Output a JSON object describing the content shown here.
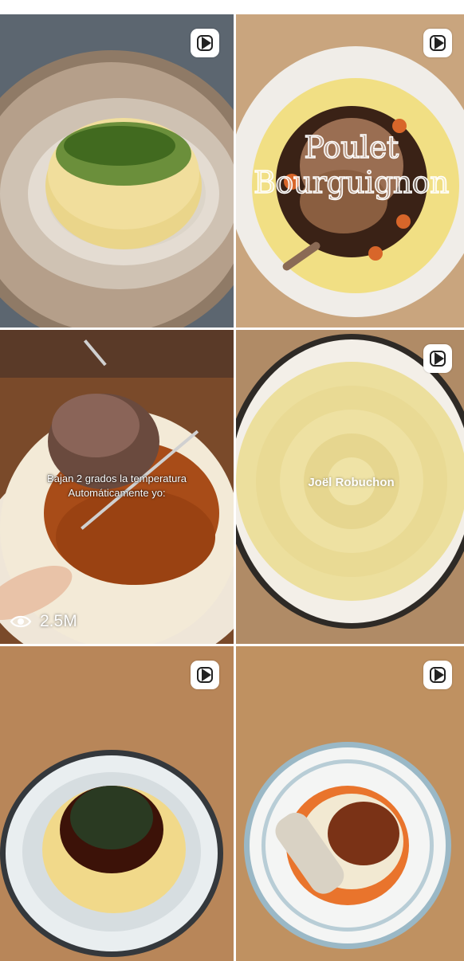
{
  "tiles": [
    {
      "id": "puree-chives",
      "is_reel": true
    },
    {
      "id": "poulet-bourguignon",
      "is_reel": true,
      "title": "Poulet\nBourguignon"
    },
    {
      "id": "braised-beef",
      "is_reel": false,
      "caption_line1": "Bajan 2 grados la temperatura",
      "caption_line2": "Automáticamente yo:",
      "views": "2.5M"
    },
    {
      "id": "joel-robuchon",
      "is_reel": true,
      "label": "Joël Robuchon"
    },
    {
      "id": "short-rib",
      "is_reel": true
    },
    {
      "id": "bolognese-parmesan",
      "is_reel": true
    }
  ],
  "colors": {
    "puree": "#f0dc9a",
    "sauce": "#a8501e",
    "chives": "#3e6b1e",
    "wood": "#c49a6c",
    "plate": "#f4f1ec"
  }
}
